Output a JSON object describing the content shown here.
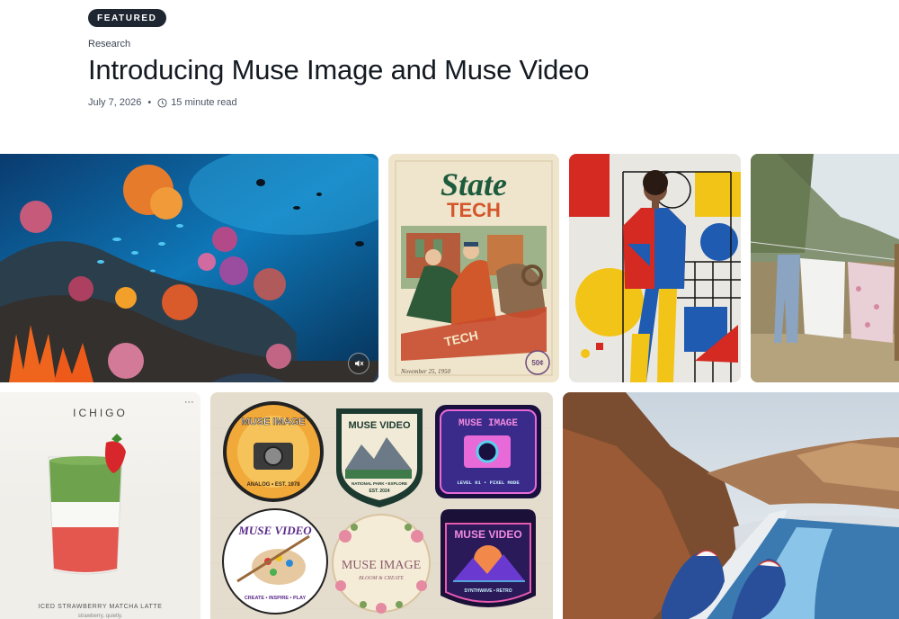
{
  "post": {
    "badge": "FEATURED",
    "category": "Research",
    "title": "Introducing Muse Image and Muse Video",
    "date": "July 7, 2026",
    "read_time": "15 minute read"
  },
  "gallery": {
    "poster": {
      "line1": "State",
      "line2": "TECH",
      "banner": "TECH",
      "date": "November 25, 1950",
      "seal": "50¢"
    },
    "ichigo": {
      "brand": "ICHIGO",
      "caption": "ICED STRAWBERRY MATCHA LATTE",
      "subline": "strawberry, quietly."
    },
    "patches": [
      {
        "title": "MUSE IMAGE",
        "sub": "ANALOG • EST. 1978"
      },
      {
        "title": "MUSE VIDEO",
        "sub": "NATIONAL PARK • EXPLORE",
        "sub2": "EST. 2024"
      },
      {
        "title": "MUSE IMAGE",
        "sub": "LEVEL 01 • PIXEL MODE"
      },
      {
        "title": "MUSE VIDEO",
        "sub": "CREATE • INSPIRE • PLAY"
      },
      {
        "title": "MUSE IMAGE",
        "sub": "BLOOM & CREATE"
      },
      {
        "title": "MUSE VIDEO",
        "sub": "SYNTHWAVE • RETRO"
      }
    ]
  },
  "colors": {
    "badge_bg": "#1e2631",
    "title_text": "#141a22"
  },
  "icons": {
    "clock": "clock-icon",
    "mute": "mute-icon"
  }
}
